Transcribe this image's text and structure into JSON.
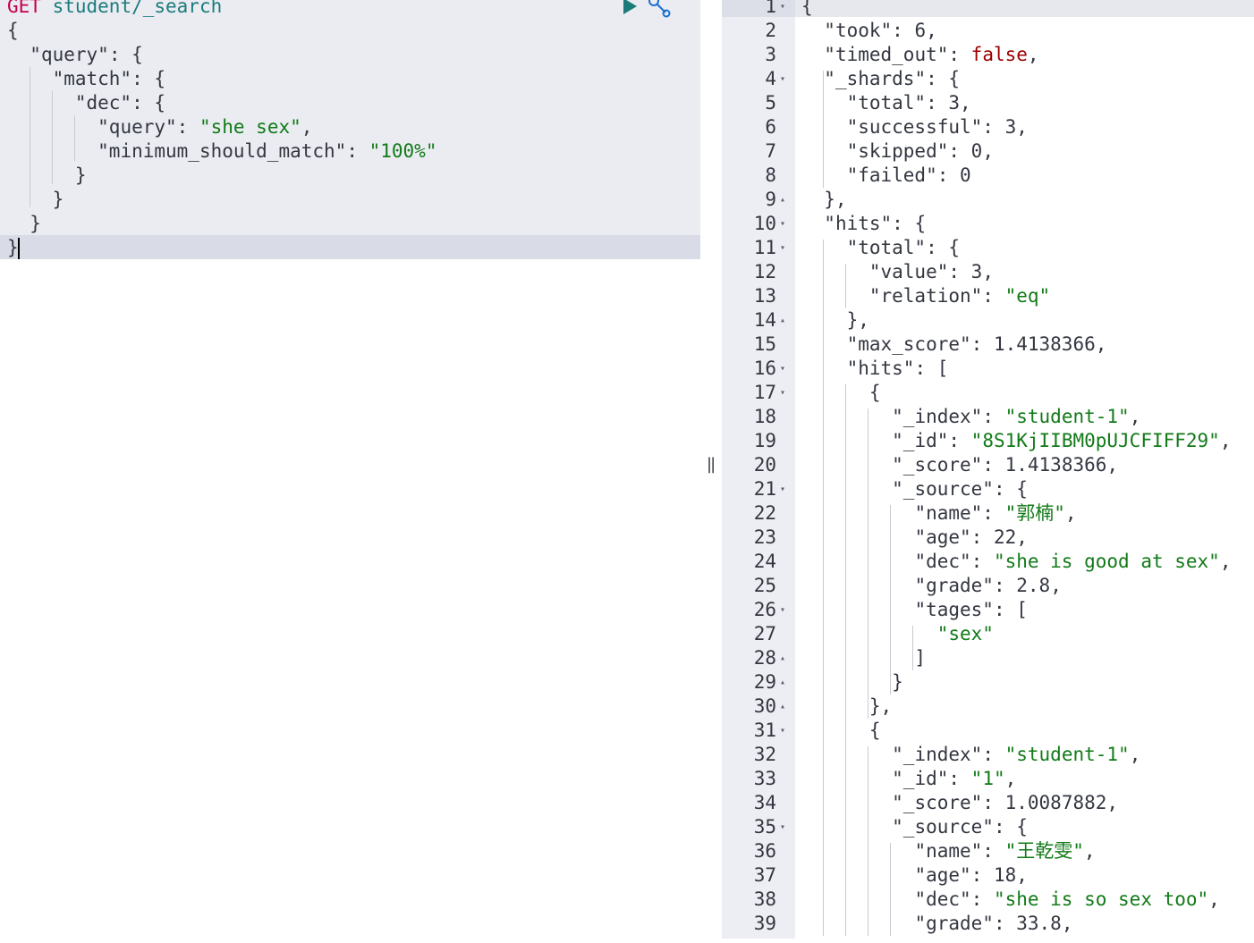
{
  "request": {
    "method": "GET",
    "path": "student/_search",
    "lines": [
      [
        "{"
      ],
      [
        "  ",
        {
          "k": "\"query\""
        },
        ": {"
      ],
      [
        "    ",
        {
          "k": "\"match\""
        },
        ": {"
      ],
      [
        "      ",
        {
          "k": "\"dec\""
        },
        ": {"
      ],
      [
        "        ",
        {
          "k": "\"query\""
        },
        ": ",
        {
          "s": "\"she sex\""
        },
        ","
      ],
      [
        "        ",
        {
          "k": "\"minimum_should_match\""
        },
        ": ",
        {
          "s": "\"100%\""
        }
      ],
      [
        "      }"
      ],
      [
        "    }"
      ],
      [
        "  }"
      ],
      [
        "}"
      ]
    ]
  },
  "toolbar": {
    "run_icon": "play-icon",
    "settings_icon": "wrench-icon"
  },
  "response": {
    "lines": [
      {
        "num": "1",
        "fold": "down",
        "parts": [
          "{"
        ]
      },
      {
        "num": "2",
        "parts": [
          "  ",
          {
            "k": "\"took\""
          },
          ": ",
          {
            "n": "6"
          },
          ","
        ]
      },
      {
        "num": "3",
        "parts": [
          "  ",
          {
            "k": "\"timed_out\""
          },
          ": ",
          {
            "kw": "false"
          },
          ","
        ]
      },
      {
        "num": "4",
        "fold": "down",
        "parts": [
          "  ",
          {
            "k": "\"_shards\""
          },
          ": {"
        ]
      },
      {
        "num": "5",
        "parts": [
          "    ",
          {
            "k": "\"total\""
          },
          ": ",
          {
            "n": "3"
          },
          ","
        ]
      },
      {
        "num": "6",
        "parts": [
          "    ",
          {
            "k": "\"successful\""
          },
          ": ",
          {
            "n": "3"
          },
          ","
        ]
      },
      {
        "num": "7",
        "parts": [
          "    ",
          {
            "k": "\"skipped\""
          },
          ": ",
          {
            "n": "0"
          },
          ","
        ]
      },
      {
        "num": "8",
        "parts": [
          "    ",
          {
            "k": "\"failed\""
          },
          ": ",
          {
            "n": "0"
          }
        ]
      },
      {
        "num": "9",
        "fold": "up",
        "parts": [
          "  },"
        ]
      },
      {
        "num": "10",
        "fold": "down",
        "parts": [
          "  ",
          {
            "k": "\"hits\""
          },
          ": {"
        ]
      },
      {
        "num": "11",
        "fold": "down",
        "parts": [
          "    ",
          {
            "k": "\"total\""
          },
          ": {"
        ]
      },
      {
        "num": "12",
        "parts": [
          "      ",
          {
            "k": "\"value\""
          },
          ": ",
          {
            "n": "3"
          },
          ","
        ]
      },
      {
        "num": "13",
        "parts": [
          "      ",
          {
            "k": "\"relation\""
          },
          ": ",
          {
            "s": "\"eq\""
          }
        ]
      },
      {
        "num": "14",
        "fold": "up",
        "parts": [
          "    },"
        ]
      },
      {
        "num": "15",
        "parts": [
          "    ",
          {
            "k": "\"max_score\""
          },
          ": ",
          {
            "n": "1.4138366"
          },
          ","
        ]
      },
      {
        "num": "16",
        "fold": "down",
        "parts": [
          "    ",
          {
            "k": "\"hits\""
          },
          ": ["
        ]
      },
      {
        "num": "17",
        "fold": "down",
        "parts": [
          "      {"
        ]
      },
      {
        "num": "18",
        "parts": [
          "        ",
          {
            "k": "\"_index\""
          },
          ": ",
          {
            "s": "\"student-1\""
          },
          ","
        ]
      },
      {
        "num": "19",
        "parts": [
          "        ",
          {
            "k": "\"_id\""
          },
          ": ",
          {
            "s": "\"8S1KjIIBM0pUJCFIFF29\""
          },
          ","
        ]
      },
      {
        "num": "20",
        "parts": [
          "        ",
          {
            "k": "\"_score\""
          },
          ": ",
          {
            "n": "1.4138366"
          },
          ","
        ]
      },
      {
        "num": "21",
        "fold": "down",
        "parts": [
          "        ",
          {
            "k": "\"_source\""
          },
          ": {"
        ]
      },
      {
        "num": "22",
        "parts": [
          "          ",
          {
            "k": "\"name\""
          },
          ": ",
          {
            "s": "\"郭楠\""
          },
          ","
        ]
      },
      {
        "num": "23",
        "parts": [
          "          ",
          {
            "k": "\"age\""
          },
          ": ",
          {
            "n": "22"
          },
          ","
        ]
      },
      {
        "num": "24",
        "parts": [
          "          ",
          {
            "k": "\"dec\""
          },
          ": ",
          {
            "s": "\"she is good at sex\""
          },
          ","
        ]
      },
      {
        "num": "25",
        "parts": [
          "          ",
          {
            "k": "\"grade\""
          },
          ": ",
          {
            "n": "2.8"
          },
          ","
        ]
      },
      {
        "num": "26",
        "fold": "down",
        "parts": [
          "          ",
          {
            "k": "\"tages\""
          },
          ": ["
        ]
      },
      {
        "num": "27",
        "parts": [
          "            ",
          {
            "s": "\"sex\""
          }
        ]
      },
      {
        "num": "28",
        "fold": "up",
        "parts": [
          "          ]"
        ]
      },
      {
        "num": "29",
        "fold": "up",
        "parts": [
          "        }"
        ]
      },
      {
        "num": "30",
        "fold": "up",
        "parts": [
          "      },"
        ]
      },
      {
        "num": "31",
        "fold": "down",
        "parts": [
          "      {"
        ]
      },
      {
        "num": "32",
        "parts": [
          "        ",
          {
            "k": "\"_index\""
          },
          ": ",
          {
            "s": "\"student-1\""
          },
          ","
        ]
      },
      {
        "num": "33",
        "parts": [
          "        ",
          {
            "k": "\"_id\""
          },
          ": ",
          {
            "s": "\"1\""
          },
          ","
        ]
      },
      {
        "num": "34",
        "parts": [
          "        ",
          {
            "k": "\"_score\""
          },
          ": ",
          {
            "n": "1.0087882"
          },
          ","
        ]
      },
      {
        "num": "35",
        "fold": "down",
        "parts": [
          "        ",
          {
            "k": "\"_source\""
          },
          ": {"
        ]
      },
      {
        "num": "36",
        "parts": [
          "          ",
          {
            "k": "\"name\""
          },
          ": ",
          {
            "s": "\"王乾雯\""
          },
          ","
        ]
      },
      {
        "num": "37",
        "parts": [
          "          ",
          {
            "k": "\"age\""
          },
          ": ",
          {
            "n": "18"
          },
          ","
        ]
      },
      {
        "num": "38",
        "parts": [
          "          ",
          {
            "k": "\"dec\""
          },
          ": ",
          {
            "s": "\"she is so sex too\""
          },
          ","
        ]
      },
      {
        "num": "39",
        "parts": [
          "          ",
          {
            "k": "\"grade\""
          },
          ": ",
          {
            "n": "33.8"
          },
          ","
        ]
      }
    ]
  },
  "colors": {
    "method": "#c5004f",
    "path": "#1b7b7b",
    "string": "#117a17",
    "keyword": "#9b0000",
    "text": "#343741"
  }
}
